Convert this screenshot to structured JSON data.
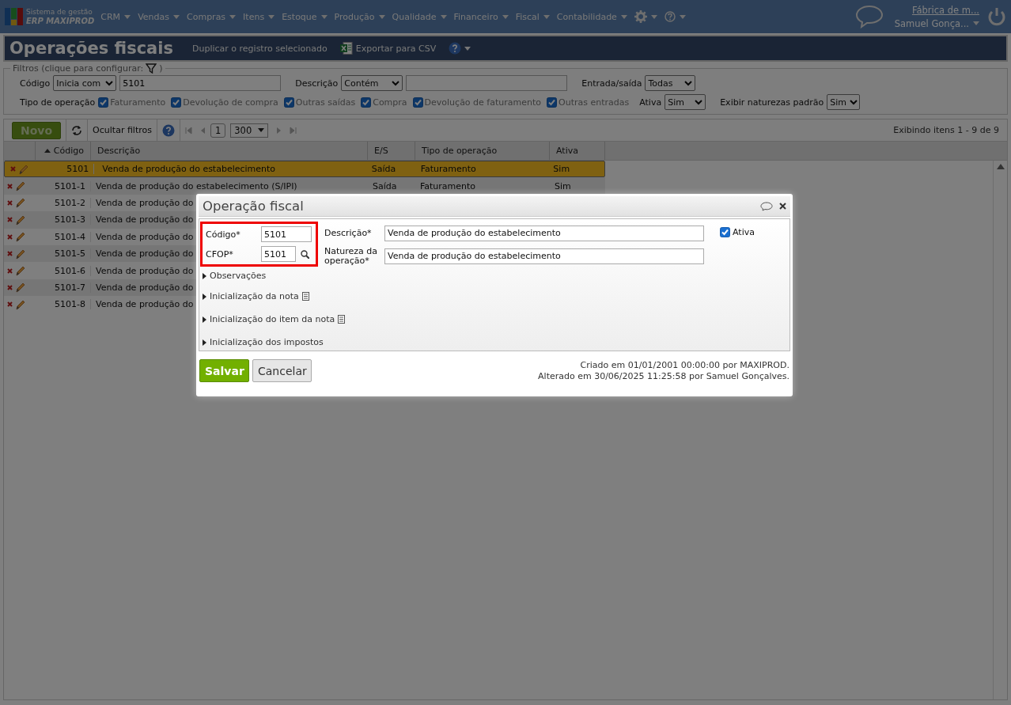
{
  "nav": {
    "brand_top": "Sistema de gestão",
    "brand_bottom": "ERP MAXIPROD",
    "menus": [
      "CRM",
      "Vendas",
      "Compras",
      "Itens",
      "Estoque",
      "Produção",
      "Qualidade",
      "Financeiro",
      "Fiscal",
      "Contabilidade"
    ],
    "company": "Fábrica de m...",
    "user": "Samuel Gonça..."
  },
  "page": {
    "title": "Operações fiscais",
    "duplicate": "Duplicar o registro selecionado",
    "export": "Exportar para CSV"
  },
  "filters": {
    "legend": "Filtros (clique para configurar:",
    "legend_end": ")",
    "code": {
      "label": "Código",
      "mode": "Inicia com",
      "value": "5101"
    },
    "description": {
      "label": "Descrição",
      "mode": "Contém"
    },
    "direction": {
      "label": "Entrada/saída",
      "value": "Todas"
    },
    "operation_type": {
      "label": "Tipo de operação",
      "options": [
        {
          "label": "Faturamento",
          "checked": true
        },
        {
          "label": "Devolução de compra",
          "checked": true
        },
        {
          "label": "Outras saídas",
          "checked": true
        },
        {
          "label": "Compra",
          "checked": true
        },
        {
          "label": "Devolução de faturamento",
          "checked": true
        },
        {
          "label": "Outras entradas",
          "checked": true
        }
      ]
    },
    "active": {
      "label": "Ativa",
      "value": "Sim"
    },
    "defaults": {
      "label": "Exibir naturezas padrão",
      "value": "Sim"
    }
  },
  "toolbar": {
    "new": "Novo",
    "hide_filters": "Ocultar filtros",
    "page": "1",
    "page_size": "300",
    "summary": "Exibindo itens 1 - 9 de 9"
  },
  "table": {
    "columns": [
      {
        "label": "Código",
        "sorted": true
      },
      {
        "label": "Descrição",
        "sorted": false
      },
      {
        "label": "E/S",
        "sorted": false
      },
      {
        "label": "Tipo de operação",
        "sorted": false
      },
      {
        "label": "Ativa",
        "sorted": false
      }
    ],
    "rows": [
      {
        "cells": [
          "5101",
          "Venda de produção do estabelecimento",
          "Saída",
          "Faturamento",
          "Sim"
        ],
        "selected": true
      },
      {
        "cells": [
          "5101-1",
          "Venda de produção do estabelecimento (S/IPI)",
          "Saída",
          "Faturamento",
          "Sim"
        ],
        "selected": false
      },
      {
        "cells": [
          "5101-2",
          "Venda de produção do"
        ],
        "selected": false
      },
      {
        "cells": [
          "5101-3",
          "Venda de produção do"
        ],
        "selected": false
      },
      {
        "cells": [
          "5101-4",
          "Venda de produção do"
        ],
        "selected": false
      },
      {
        "cells": [
          "5101-5",
          "Venda de produção do"
        ],
        "selected": false
      },
      {
        "cells": [
          "5101-6",
          "Venda de produção do"
        ],
        "selected": false
      },
      {
        "cells": [
          "5101-7",
          "Venda de produção do"
        ],
        "selected": false
      },
      {
        "cells": [
          "5101-8",
          "Venda de produção do"
        ],
        "selected": false
      }
    ]
  },
  "dialog": {
    "title": "Operação fiscal",
    "highlighted": true,
    "code": {
      "label": "Código*",
      "value": "5101"
    },
    "cfop": {
      "label": "CFOP*",
      "value": "5101"
    },
    "description": {
      "label": "Descrição*",
      "value": "Venda de produção do estabelecimento"
    },
    "nature": {
      "label": "Natureza da operação*",
      "value": "Venda de produção do estabelecimento"
    },
    "active": {
      "label": "Ativa",
      "checked": true
    },
    "sections": [
      {
        "label": "Observações",
        "note_icon": false
      },
      {
        "label": "Inicialização da nota",
        "note_icon": true
      },
      {
        "label": "Inicialização do item da nota",
        "note_icon": true
      },
      {
        "label": "Inicialização dos impostos",
        "note_icon": false
      }
    ],
    "save": "Salvar",
    "cancel": "Cancelar",
    "created": "Criado em 01/01/2001 00:00:00 por MAXIPROD.",
    "modified": "Alterado em 30/06/2025 11:25:58 por Samuel Gonçalves."
  }
}
